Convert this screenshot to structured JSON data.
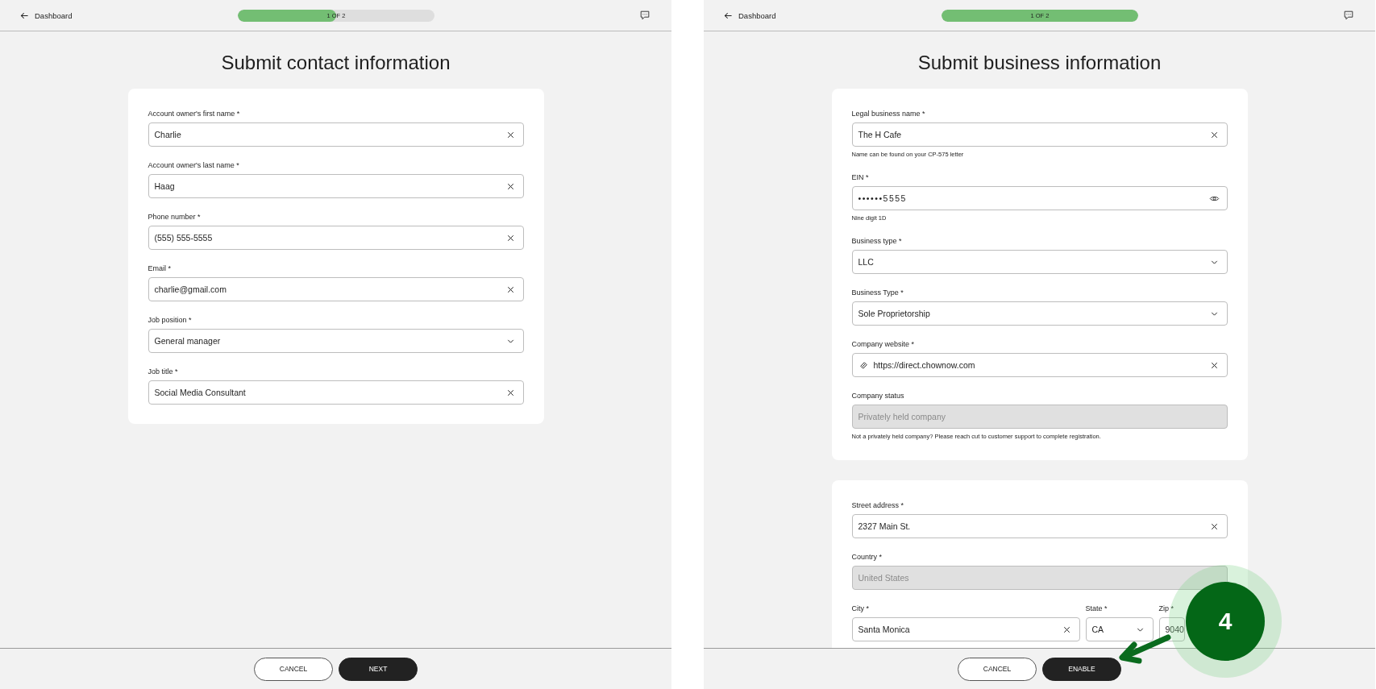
{
  "panels": [
    {
      "back_label": "Dashboard",
      "progress": {
        "label": "1 OF 2",
        "level": 0.5
      },
      "title": "Submit contact information",
      "cards": [
        {
          "fields": [
            {
              "kind": "text",
              "label": "Account owner's first name *",
              "value": "Charlie"
            },
            {
              "kind": "text",
              "label": "Account owner's last name *",
              "value": "Haag"
            },
            {
              "kind": "text",
              "label": "Phone number *",
              "value": "(555) 555-5555"
            },
            {
              "kind": "text",
              "label": "Email *",
              "value": "charlie@gmail.com"
            },
            {
              "kind": "select",
              "label": "Job position *",
              "value": "General manager"
            },
            {
              "kind": "text",
              "label": "Job title *",
              "value": "Social Media Consultant"
            }
          ]
        }
      ],
      "buttons": [
        {
          "label": "CANCEL",
          "kind": "secondary"
        },
        {
          "label": "NEXT",
          "kind": "primary"
        }
      ]
    },
    {
      "back_label": "Dashboard",
      "progress": {
        "label": "1 OF 2",
        "level": 1
      },
      "title": "Submit business information",
      "cards": [
        {
          "fields": [
            {
              "kind": "text",
              "label": "Legal business name *",
              "value": "The H Cafe",
              "helper": "Name can be found on your CP-575 letter"
            },
            {
              "kind": "password",
              "label": "EIN *",
              "value": "••••••5555",
              "helper": "Nine digit 1D"
            },
            {
              "kind": "select",
              "label": "Business type *",
              "value": "LLC"
            },
            {
              "kind": "select",
              "label": "Business Type *",
              "value": "Sole Proprietorship"
            },
            {
              "kind": "link",
              "label": "Company website *",
              "value": "https://direct.chownow.com"
            },
            {
              "kind": "disabled",
              "label": "Company status",
              "value": "Privately held company",
              "helper": "Not a privately held company? Please reach cut to customer support to complete registration."
            }
          ]
        },
        {
          "fields": [
            {
              "kind": "text",
              "label": "Street address *",
              "value": "2327 Main St."
            },
            {
              "kind": "disabled",
              "label": "Country *",
              "value": "United States"
            },
            {
              "kind": "row",
              "fields": [
                {
                  "kind": "text",
                  "label": "City *",
                  "value": "Santa Monica"
                },
                {
                  "kind": "select",
                  "label": "State *",
                  "value": "CA"
                },
                {
                  "kind": "plain",
                  "label": "Zip *",
                  "value": "9040"
                }
              ]
            }
          ]
        }
      ],
      "buttons": [
        {
          "label": "CANCEL",
          "kind": "secondary"
        },
        {
          "label": "ENABLE",
          "kind": "primary"
        }
      ],
      "step_marker": {
        "label": "4"
      }
    }
  ]
}
